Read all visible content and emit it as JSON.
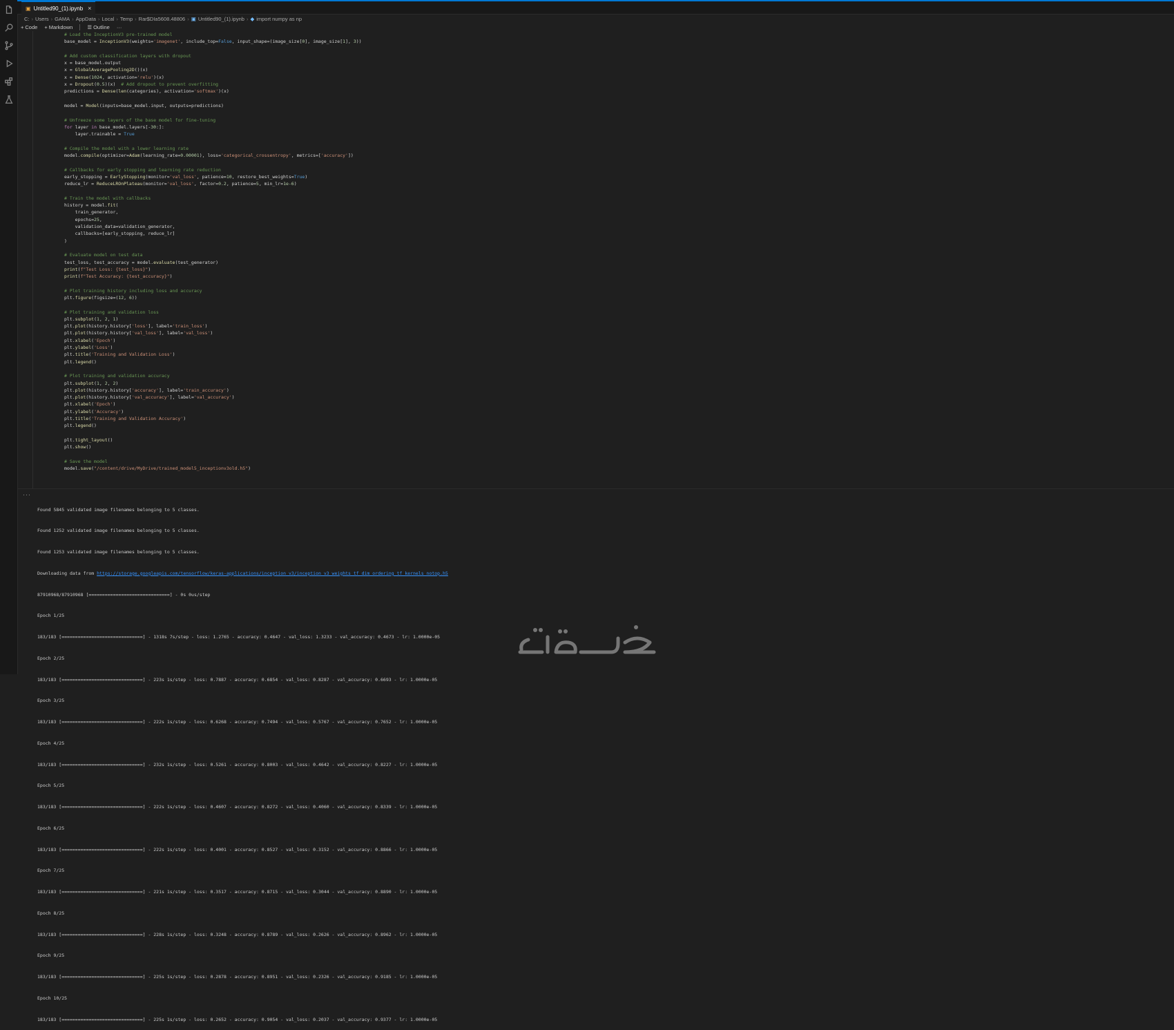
{
  "tab": {
    "title": "Untitled90_(1).ipynb",
    "close": "×"
  },
  "breadcrumb": [
    "C:",
    "Users",
    "GAMA",
    "AppData",
    "Local",
    "Temp",
    "Rar$DIa5608.48806",
    "Untitled90_(1).ipynb",
    "import numpy as np"
  ],
  "toolbar": {
    "code": "Code",
    "markdown": "Markdown",
    "outline": "Outline",
    "more": "···"
  },
  "code": [
    "# Load the InceptionV3 pre-trained model",
    "base_model = InceptionV3(weights='imagenet', include_top=False, input_shape=(image_size[0], image_size[1], 3))",
    "",
    "# Add custom classification layers with dropout",
    "x = base_model.output",
    "x = GlobalAveragePooling2D()(x)",
    "x = Dense(1024, activation='relu')(x)",
    "x = Dropout(0.5)(x)  # Add dropout to prevent overfitting",
    "predictions = Dense(len(categories), activation='softmax')(x)",
    "",
    "model = Model(inputs=base_model.input, outputs=predictions)",
    "",
    "# Unfreeze some layers of the base model for fine-tuning",
    "for layer in base_model.layers[-30:]:",
    "    layer.trainable = True",
    "",
    "# Compile the model with a lower learning rate",
    "model.compile(optimizer=Adam(learning_rate=0.00001), loss='categorical_crossentropy', metrics=['accuracy'])",
    "",
    "# Callbacks for early stopping and learning rate reduction",
    "early_stopping = EarlyStopping(monitor='val_loss', patience=10, restore_best_weights=True)",
    "reduce_lr = ReduceLROnPlateau(monitor='val_loss', factor=0.2, patience=5, min_lr=1e-6)",
    "",
    "# Train the model with callbacks",
    "history = model.fit(",
    "    train_generator,",
    "    epochs=25,",
    "    validation_data=validation_generator,",
    "    callbacks=[early_stopping, reduce_lr]",
    ")",
    "",
    "# Evaluate model on test data",
    "test_loss, test_accuracy = model.evaluate(test_generator)",
    "print(f\"Test Loss: {test_loss}\")",
    "print(f\"Test Accuracy: {test_accuracy}\")",
    "",
    "# Plot training history including loss and accuracy",
    "plt.figure(figsize=(12, 6))",
    "",
    "# Plot training and validation loss",
    "plt.subplot(1, 2, 1)",
    "plt.plot(history.history['loss'], label='train_loss')",
    "plt.plot(history.history['val_loss'], label='val_loss')",
    "plt.xlabel('Epoch')",
    "plt.ylabel('Loss')",
    "plt.title('Training and Validation Loss')",
    "plt.legend()",
    "",
    "# Plot training and validation accuracy",
    "plt.subplot(1, 2, 2)",
    "plt.plot(history.history['accuracy'], label='train_accuracy')",
    "plt.plot(history.history['val_accuracy'], label='val_accuracy')",
    "plt.xlabel('Epoch')",
    "plt.ylabel('Accuracy')",
    "plt.title('Training and Validation Accuracy')",
    "plt.legend()",
    "",
    "plt.tight_layout()",
    "plt.show()",
    "",
    "# Save the model",
    "model.save(\"/content/drive/MyDrive/trained_model5_inceptionv3old.h5\")"
  ],
  "output_more": "···",
  "output": {
    "pre": [
      "Found 5845 validated image filenames belonging to 5 classes.",
      "Found 1252 validated image filenames belonging to 5 classes.",
      "Found 1253 validated image filenames belonging to 5 classes."
    ],
    "download_prefix": "Downloading data from ",
    "download_url": "https://storage.googleapis.com/tensorflow/keras-applications/inception_v3/inception_v3_weights_tf_dim_ordering_tf_kernels_notop.h5",
    "post": [
      "87910968/87910968 [==============================] - 0s 0us/step",
      "Epoch 1/25",
      "183/183 [==============================] - 1318s 7s/step - loss: 1.2765 - accuracy: 0.4647 - val_loss: 1.3233 - val_accuracy: 0.4673 - lr: 1.0000e-05",
      "Epoch 2/25",
      "183/183 [==============================] - 223s 1s/step - loss: 0.7887 - accuracy: 0.6854 - val_loss: 0.8287 - val_accuracy: 0.6693 - lr: 1.0000e-05",
      "Epoch 3/25",
      "183/183 [==============================] - 222s 1s/step - loss: 0.6268 - accuracy: 0.7494 - val_loss: 0.5767 - val_accuracy: 0.7652 - lr: 1.0000e-05",
      "Epoch 4/25",
      "183/183 [==============================] - 232s 1s/step - loss: 0.5261 - accuracy: 0.8003 - val_loss: 0.4642 - val_accuracy: 0.8227 - lr: 1.0000e-05",
      "Epoch 5/25",
      "183/183 [==============================] - 222s 1s/step - loss: 0.4607 - accuracy: 0.8272 - val_loss: 0.4060 - val_accuracy: 0.8339 - lr: 1.0000e-05",
      "Epoch 6/25",
      "183/183 [==============================] - 222s 1s/step - loss: 0.4001 - accuracy: 0.8527 - val_loss: 0.3152 - val_accuracy: 0.8866 - lr: 1.0000e-05",
      "Epoch 7/25",
      "183/183 [==============================] - 221s 1s/step - loss: 0.3517 - accuracy: 0.8715 - val_loss: 0.3044 - val_accuracy: 0.8890 - lr: 1.0000e-05",
      "Epoch 8/25",
      "183/183 [==============================] - 228s 1s/step - loss: 0.3248 - accuracy: 0.8789 - val_loss: 0.2626 - val_accuracy: 0.8962 - lr: 1.0000e-05",
      "Epoch 9/25",
      "183/183 [==============================] - 225s 1s/step - loss: 0.2878 - accuracy: 0.8951 - val_loss: 0.2326 - val_accuracy: 0.9185 - lr: 1.0000e-05",
      "Epoch 10/25",
      "183/183 [==============================] - 225s 1s/step - loss: 0.2652 - accuracy: 0.9054 - val_loss: 0.2037 - val_accuracy: 0.9377 - lr: 1.0000e-05"
    ]
  },
  "watermark": "خمسات",
  "colors": {
    "accent": "#0078d4",
    "editor_bg": "#1f1f1f",
    "comment": "#6a9955",
    "string": "#ce9178",
    "link": "#3794ff"
  }
}
